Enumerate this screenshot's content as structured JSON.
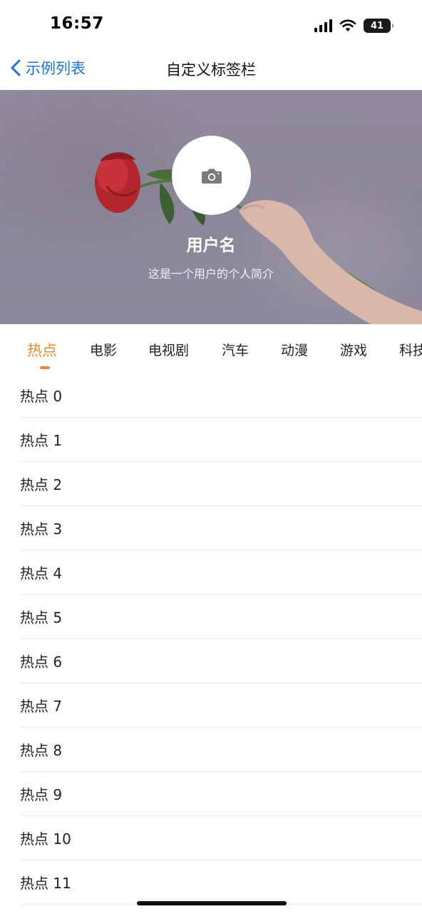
{
  "status_bar": {
    "time": "16:57",
    "battery": "41"
  },
  "nav": {
    "back_label": "示例列表",
    "title": "自定义标签栏"
  },
  "profile": {
    "username": "用户名",
    "bio": "这是一个用户的个人简介",
    "avatar_icon": "camera-icon"
  },
  "tabs": [
    {
      "label": "热点",
      "active": true
    },
    {
      "label": "电影",
      "active": false
    },
    {
      "label": "电视剧",
      "active": false
    },
    {
      "label": "汽车",
      "active": false
    },
    {
      "label": "动漫",
      "active": false
    },
    {
      "label": "游戏",
      "active": false
    },
    {
      "label": "科技",
      "active": false
    }
  ],
  "list": [
    {
      "label": "热点 0"
    },
    {
      "label": "热点 1"
    },
    {
      "label": "热点 2"
    },
    {
      "label": "热点 3"
    },
    {
      "label": "热点 4"
    },
    {
      "label": "热点 5"
    },
    {
      "label": "热点 6"
    },
    {
      "label": "热点 7"
    },
    {
      "label": "热点 8"
    },
    {
      "label": "热点 9"
    },
    {
      "label": "热点 10"
    },
    {
      "label": "热点 11"
    }
  ],
  "colors": {
    "accent": "#ee8a2a",
    "link": "#1a73e8",
    "header_bg": "#8e899c"
  }
}
